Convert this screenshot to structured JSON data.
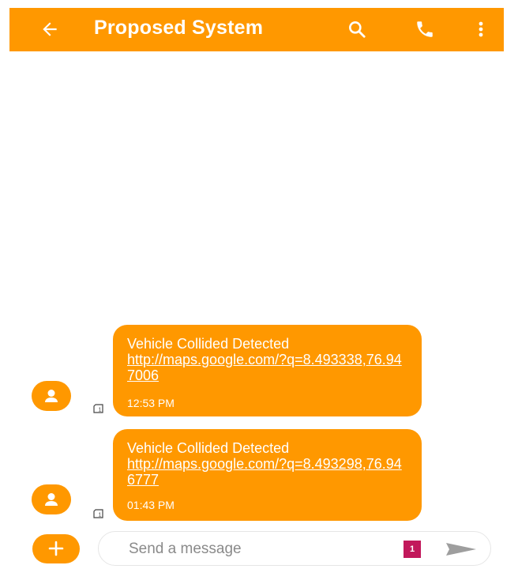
{
  "header": {
    "title": "Proposed System",
    "icons": [
      "back-arrow-icon",
      "search-icon",
      "phone-icon",
      "more-vert-icon"
    ]
  },
  "messages": [
    {
      "title": "Vehicle Collided Detected",
      "link": "http://maps.google.com/?q=8.493338,76.947006",
      "time": "12:53 PM",
      "sim": "1"
    },
    {
      "title": "Vehicle Collided Detected",
      "link": "http://maps.google.com/?q=8.493298,76.946777",
      "time": "01:43 PM",
      "sim": "1"
    }
  ],
  "compose": {
    "placeholder": "Send a message",
    "sim_badge": "1"
  },
  "colors": {
    "accent": "#ff9800",
    "sim_badge": "#c2185b",
    "background": "#ffffff"
  }
}
